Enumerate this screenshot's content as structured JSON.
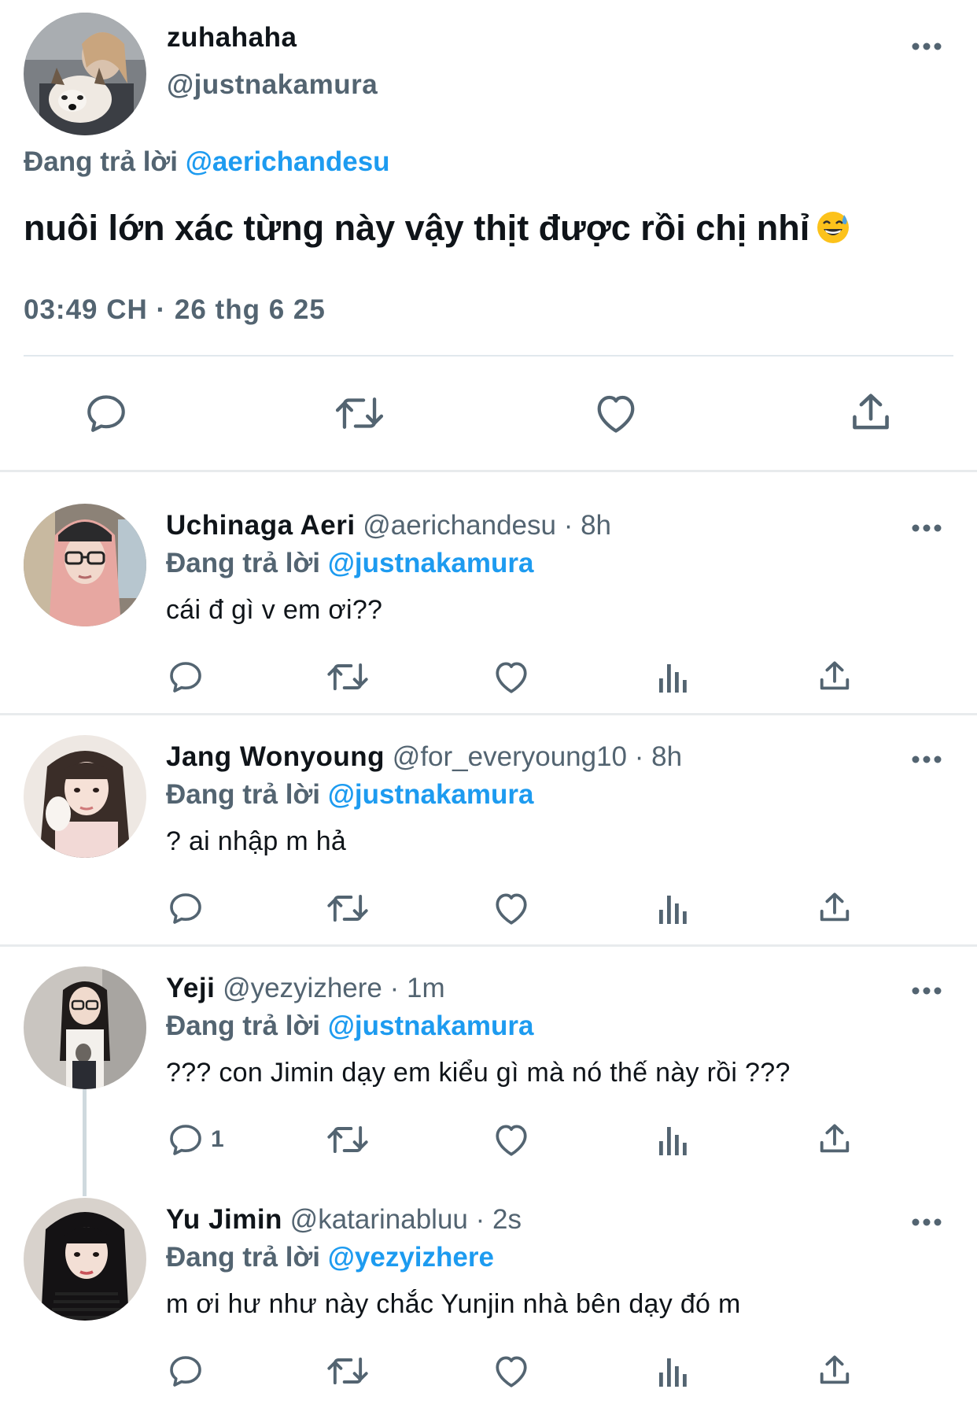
{
  "main_tweet": {
    "display_name": "zuhahaha",
    "handle": "@justnakamura",
    "reply_prefix": "Đang trả lời",
    "reply_to": "@aerichandesu",
    "text": "nuôi lớn xác từng này vậy thịt được rồi chị nhỉ",
    "emoji": "grinning-sweat-emoji",
    "timestamp": "03:49 CH · 26 thg 6 25",
    "avatar": "avatar-photo-person-with-dog"
  },
  "replies": [
    {
      "display_name": "Uchinaga Aeri",
      "meta": "@aerichandesu · 8h",
      "reply_prefix": "Đang trả lời",
      "reply_to": "@justnakamura",
      "text": "cái đ gì v em ơi??",
      "reply_count": "",
      "avatar": "avatar-photo-pink-hair-glasses"
    },
    {
      "display_name": "Jang Wonyoung",
      "meta": "@for_everyoung10 · 8h",
      "reply_prefix": "Đang trả lời",
      "reply_to": "@justnakamura",
      "text": "? ai nhập m hả",
      "reply_count": "",
      "avatar": "avatar-photo-dark-hair"
    },
    {
      "display_name": "Yeji",
      "meta": "@yezyizhere · 1m",
      "reply_prefix": "Đang trả lời",
      "reply_to": "@justnakamura",
      "text": "??? con Jimin dạy em kiểu gì mà nó thế này rồi ???",
      "reply_count": "1",
      "avatar": "avatar-photo-glasses-standing"
    },
    {
      "display_name": "Yu Jimin",
      "meta": "@katarinabluu · 2s",
      "reply_prefix": "Đang trả lời",
      "reply_to": "@yezyizhere",
      "text": "m ơi hư như này chắc Yunjin nhà bên dạy đó m",
      "reply_count": "",
      "avatar": "avatar-photo-black-hair-striped"
    }
  ],
  "icons": {
    "reply": "reply-icon",
    "retweet": "retweet-icon",
    "like": "like-icon",
    "views": "views-icon",
    "share": "share-icon",
    "more": "more-icon"
  },
  "colors": {
    "text": "#0f1419",
    "secondary": "#536471",
    "accent": "#1d9bf0",
    "divider": "#e1e8ed"
  }
}
